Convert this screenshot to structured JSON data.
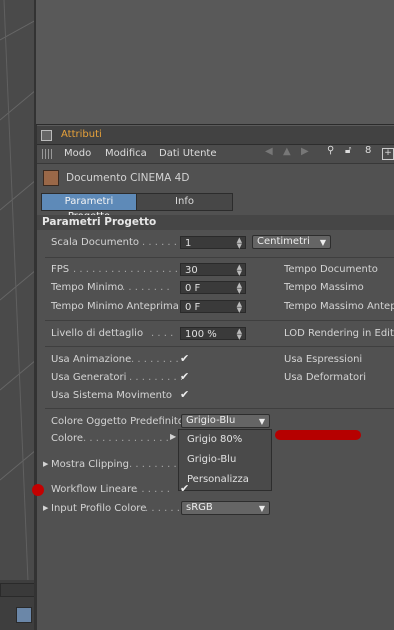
{
  "panel": {
    "title": "Attributi",
    "menu": [
      "Modo",
      "Modifica",
      "Dati Utente"
    ]
  },
  "document": {
    "title": "Documento CINEMA 4D",
    "tabs": [
      "Parametri Progetto",
      "Info"
    ],
    "active_tab": "Parametri Progetto"
  },
  "section": {
    "title": "Parametri Progetto",
    "scala": {
      "label": "Scala Documento",
      "value": "1",
      "unit": "Centimetri"
    },
    "fps": {
      "label": "FPS",
      "value": "30"
    },
    "tempo_minimo": {
      "label": "Tempo Minimo",
      "value": "0 F"
    },
    "tempo_minimo_anteprima": {
      "label": "Tempo Minimo Anteprima",
      "value": "0 F"
    },
    "right_labels": {
      "tempo_documento": "Tempo Documento",
      "tempo_massimo": "Tempo Massimo",
      "tempo_massimo_anteprima": "Tempo Massimo Antepr"
    },
    "livello": {
      "label": "Livello di dettaglio",
      "value": "100 %"
    },
    "lod": "LOD Rendering in Edito",
    "usa_animazione": "Usa Animazione",
    "usa_generatori": "Usa Generatori",
    "usa_sistema_movimento": "Usa Sistema Movimento",
    "usa_espressioni": "Usa Espressioni",
    "usa_deformatori": "Usa Deformatori",
    "colore_oggetto": {
      "label": "Colore Oggetto Predefinito",
      "value": "Grigio-Blu"
    },
    "colore": "Colore",
    "popup_options": [
      "Grigio 80%",
      "Grigio-Blu",
      "Personalizza"
    ],
    "mostra_clipping": "Mostra Clipping",
    "workflow_lineare": "Workflow Lineare",
    "input_profilo": {
      "label": "Input Profilo Colore",
      "value": "sRGB"
    }
  },
  "colors": {
    "accent": "#e8a23a",
    "annotation_red": "#b60000",
    "active_tab": "#5e8ab8"
  }
}
